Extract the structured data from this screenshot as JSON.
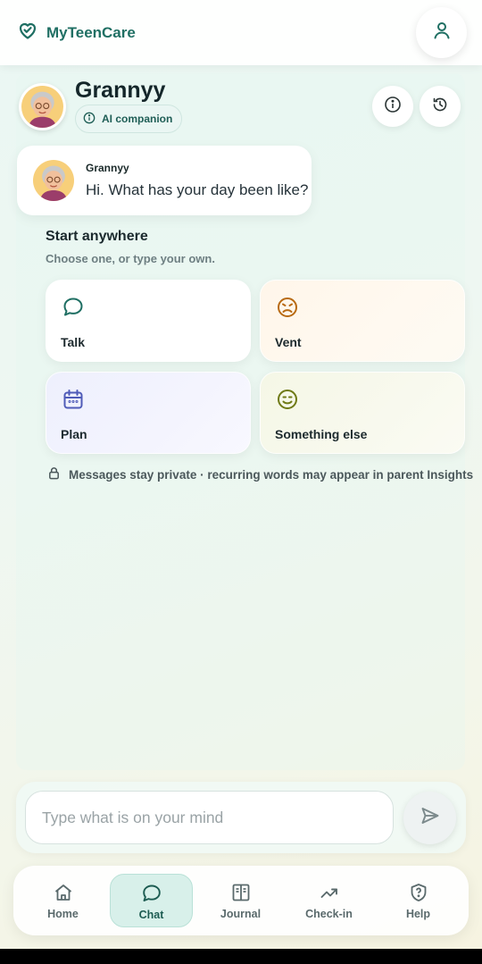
{
  "app": {
    "name": "MyTeenCare"
  },
  "companion": {
    "name": "Grannyy",
    "badge": "AI companion"
  },
  "message": {
    "sender": "Grannyy",
    "text": "Hi. What has your day been like?"
  },
  "start": {
    "title": "Start anywhere",
    "subtitle": "Choose one, or type your own.",
    "options": [
      {
        "label": "Talk",
        "icon": "chat-bubble-icon"
      },
      {
        "label": "Vent",
        "icon": "frustrated-face-icon"
      },
      {
        "label": "Plan",
        "icon": "calendar-icon"
      },
      {
        "label": "Something else",
        "icon": "smile-face-icon"
      }
    ]
  },
  "privacy": {
    "text": "Messages stay private · recurring words may appear in parent Insights"
  },
  "composer": {
    "placeholder": "Type what is on your mind"
  },
  "nav": {
    "items": [
      {
        "label": "Home",
        "icon": "home-icon"
      },
      {
        "label": "Chat",
        "icon": "chat-icon",
        "active": true
      },
      {
        "label": "Journal",
        "icon": "book-icon"
      },
      {
        "label": "Check-in",
        "icon": "trend-up-icon"
      },
      {
        "label": "Help",
        "icon": "shield-question-icon"
      }
    ]
  },
  "colors": {
    "brand": "#1f6f63",
    "active_nav_bg": "#d8f0ea",
    "vent_icon": "#b86a12",
    "plan_icon": "#4f5bb8",
    "else_icon": "#6f7a16"
  }
}
